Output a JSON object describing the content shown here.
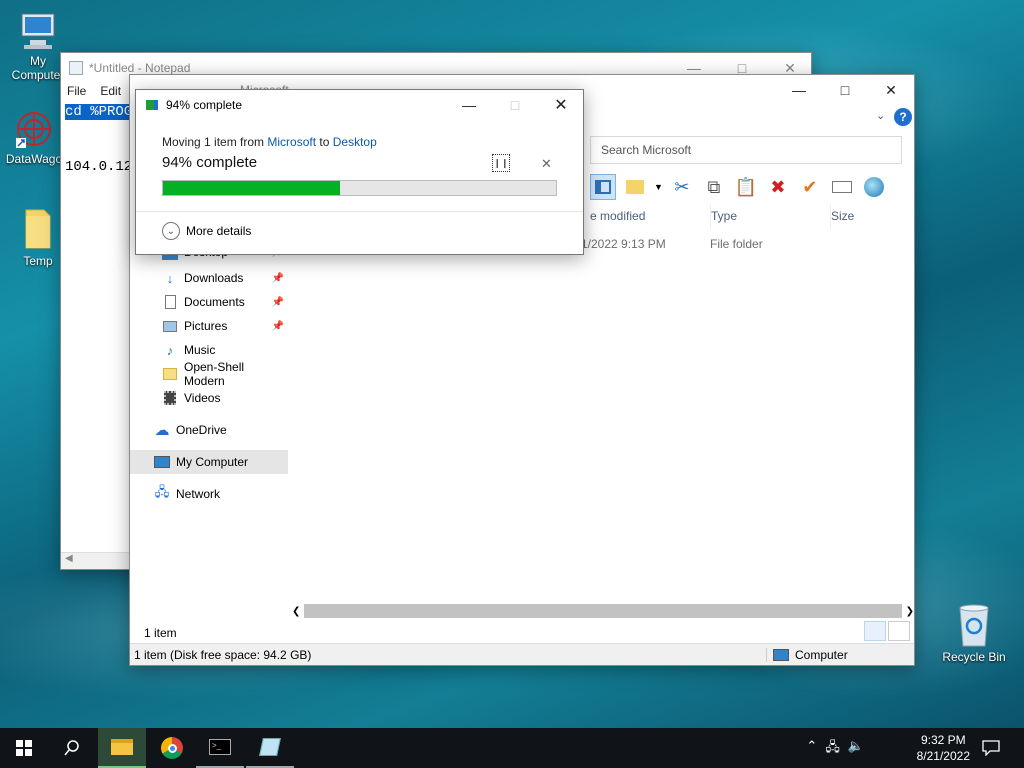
{
  "desktop": {
    "icons": [
      {
        "label": "My Computer",
        "icon": "monitor-icon"
      },
      {
        "label": "DataWago",
        "icon": "datawago-icon"
      },
      {
        "label": "Temp",
        "icon": "folder-icon"
      },
      {
        "label": "Recycle Bin",
        "icon": "recycle-bin-icon"
      }
    ]
  },
  "notepad": {
    "title": "*Untitled - Notepad",
    "menu": [
      "File",
      "Edit"
    ],
    "line1": "cd %PROG",
    "line2": "104.0.12"
  },
  "explorer": {
    "title_partial": "Microsoft",
    "search_placeholder": "Search Microsoft",
    "columns": {
      "date": "e modified",
      "type": "Type",
      "size": "Size"
    },
    "rows": [
      {
        "date": "1/2022 9:13 PM",
        "type": "File folder"
      }
    ],
    "nav": [
      {
        "label": "Desktop",
        "icon": "desktop-folder-icon",
        "pinned": true
      },
      {
        "label": "Downloads",
        "icon": "downloads-icon",
        "pinned": true
      },
      {
        "label": "Documents",
        "icon": "documents-icon",
        "pinned": true
      },
      {
        "label": "Pictures",
        "icon": "pictures-icon",
        "pinned": true
      },
      {
        "label": "Music",
        "icon": "music-icon",
        "pinned": false
      },
      {
        "label": "Open-Shell Modern",
        "icon": "folder-icon",
        "pinned": false
      },
      {
        "label": "Videos",
        "icon": "videos-icon",
        "pinned": false
      },
      {
        "label": "OneDrive",
        "icon": "onedrive-icon",
        "pinned": false
      },
      {
        "label": "My Computer",
        "icon": "computer-icon",
        "pinned": false,
        "selected": true
      },
      {
        "label": "Network",
        "icon": "network-icon",
        "pinned": false
      }
    ],
    "item_count": "1 item",
    "status_left": "1 item (Disk free space: 94.2 GB)",
    "status_right": "Computer"
  },
  "dialog": {
    "title": "94% complete",
    "moving_prefix": "Moving 1 item from ",
    "source": "Microsoft",
    "to": " to ",
    "destination": "Desktop",
    "percent_label": "94% complete",
    "progress_fraction": 0.45,
    "more_details": "More details"
  },
  "taskbar": {
    "time": "9:32 PM",
    "date": "8/21/2022"
  }
}
